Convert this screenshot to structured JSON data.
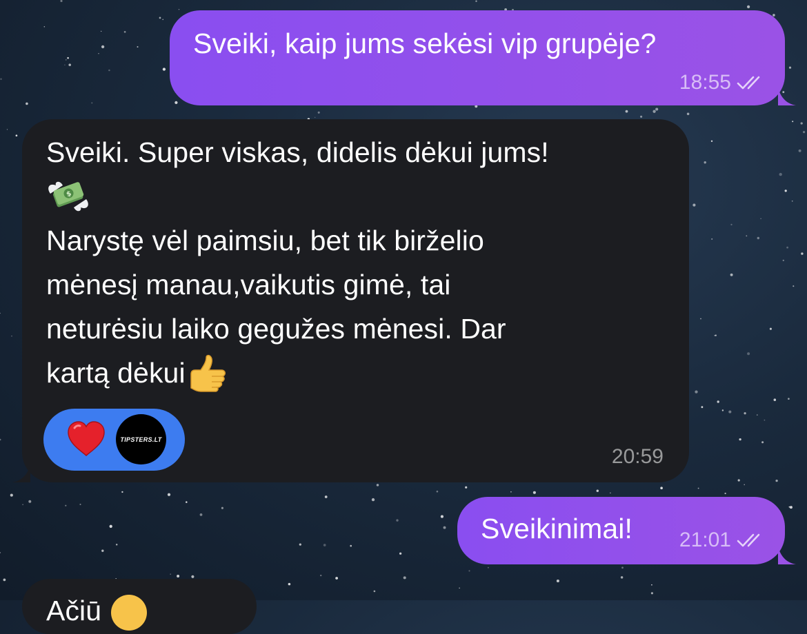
{
  "chat": {
    "messages": [
      {
        "direction": "outgoing",
        "text": "Sveiki, kaip jums sekėsi vip grupėje?",
        "time": "18:55",
        "status": "read"
      },
      {
        "direction": "incoming",
        "lines": [
          "Sveiki. Super viskas, didelis dėkui jums!",
          "",
          "Narystę vėl paimsiu, bet tik birželio",
          "mėnesį manau,vaikutis gimė, tai",
          "neturėsiu laiko gegužes mėnesi. Dar",
          "kartą dėkui"
        ],
        "emojis": [
          "money-with-wings",
          "thumbs-up"
        ],
        "time": "20:59",
        "reactions": [
          {
            "type": "emoji",
            "icon": "red-heart"
          },
          {
            "type": "avatar",
            "label": "TIPSTERS.LT"
          }
        ]
      },
      {
        "direction": "outgoing",
        "text": "Sveikinimai!",
        "time": "21:01",
        "status": "read"
      },
      {
        "direction": "incoming",
        "partial_text": "Ačiū"
      }
    ]
  },
  "colors": {
    "outgoing_bubble": "#8a4ef0",
    "incoming_bubble": "#1c1d21",
    "reaction_pill": "#3d7cf0",
    "background": "#1a2a3d"
  }
}
